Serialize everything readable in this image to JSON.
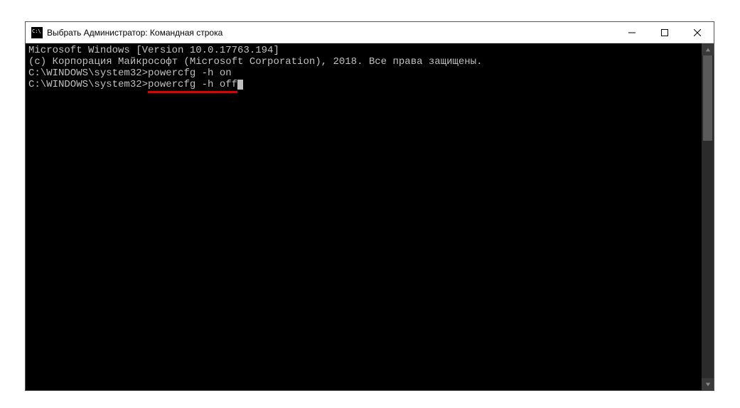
{
  "window": {
    "title": "Выбрать Администратор: Командная строка"
  },
  "console": {
    "line1": "Microsoft Windows [Version 10.0.17763.194]",
    "line2": "(c) Корпорация Майкрософт (Microsoft Corporation), 2018. Все права защищены.",
    "blank1": "",
    "prompt1_path": "C:\\WINDOWS\\system32>",
    "prompt1_cmd": "powercfg -h on",
    "blank2": "",
    "prompt2_path": "C:\\WINDOWS\\system32>",
    "prompt2_cmd": "powercfg -h off"
  }
}
